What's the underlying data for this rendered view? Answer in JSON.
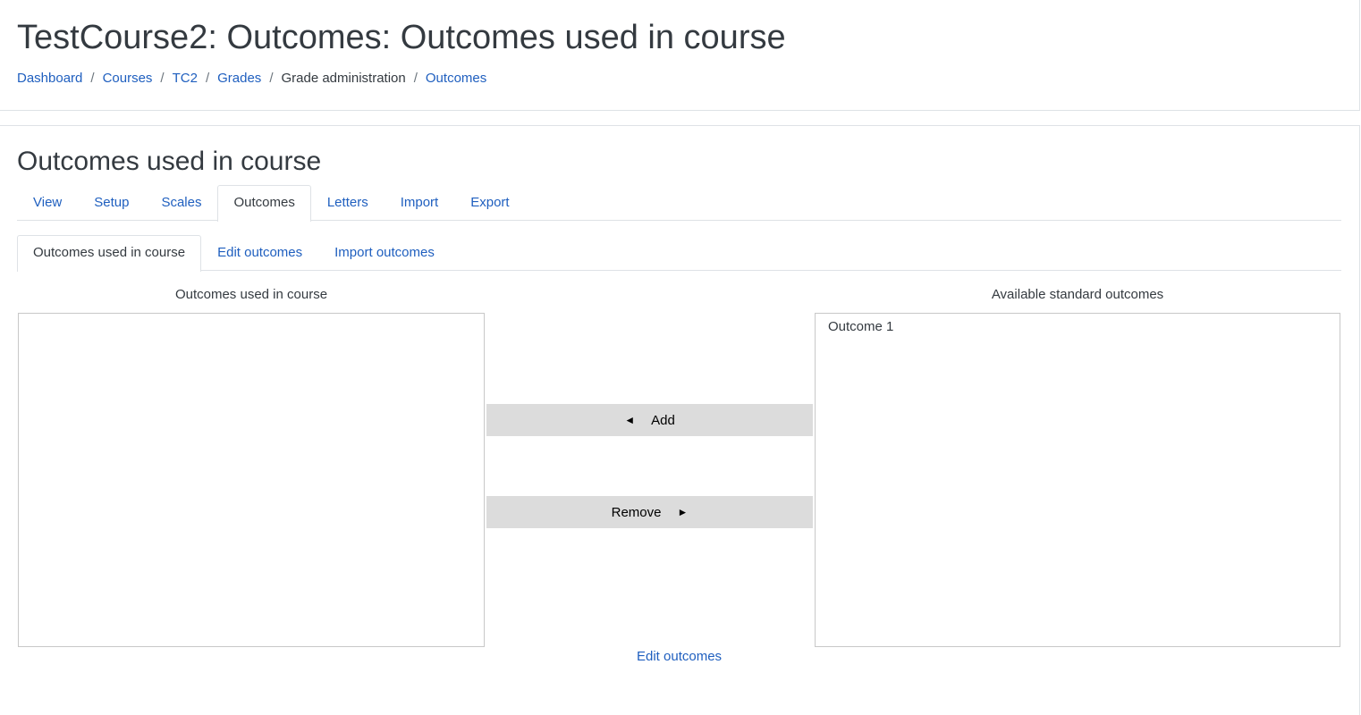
{
  "header": {
    "title": "TestCourse2: Outcomes: Outcomes used in course",
    "breadcrumb": [
      {
        "label": "Dashboard",
        "link": true
      },
      {
        "label": "Courses",
        "link": true
      },
      {
        "label": "TC2",
        "link": true
      },
      {
        "label": "Grades",
        "link": true
      },
      {
        "label": "Grade administration",
        "link": false
      },
      {
        "label": "Outcomes",
        "link": true
      }
    ],
    "separator": "/"
  },
  "main": {
    "section_title": "Outcomes used in course",
    "primary_tabs": [
      {
        "label": "View",
        "active": false
      },
      {
        "label": "Setup",
        "active": false
      },
      {
        "label": "Scales",
        "active": false
      },
      {
        "label": "Outcomes",
        "active": true
      },
      {
        "label": "Letters",
        "active": false
      },
      {
        "label": "Import",
        "active": false
      },
      {
        "label": "Export",
        "active": false
      }
    ],
    "secondary_tabs": [
      {
        "label": "Outcomes used in course",
        "active": true
      },
      {
        "label": "Edit outcomes",
        "active": false
      },
      {
        "label": "Import outcomes",
        "active": false
      }
    ],
    "used_label": "Outcomes used in course",
    "used_items": [],
    "available_label": "Available standard outcomes",
    "available_items": [
      "Outcome 1"
    ],
    "add_button": {
      "arrow": "◄",
      "label": "Add"
    },
    "remove_button": {
      "label": "Remove",
      "arrow": "►"
    },
    "edit_link": "Edit outcomes"
  },
  "colors": {
    "link": "#1f5fbf",
    "text": "#343a40",
    "button_bg": "#dcdcdc",
    "border": "#dee2e6"
  }
}
